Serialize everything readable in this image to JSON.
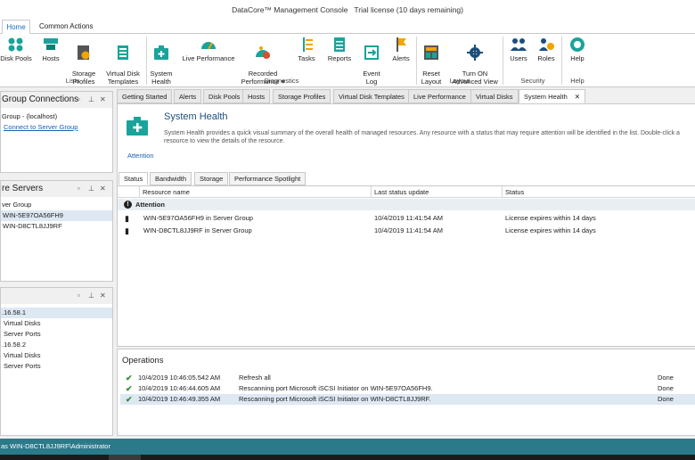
{
  "window": {
    "title": "DataCore™ Management Console",
    "license": "Trial license (10 days remaining)"
  },
  "ribbon_tabs": [
    "Home",
    "Common Actions"
  ],
  "ribbon": {
    "lists": {
      "label": "Lists",
      "buttons": [
        "Disk Pools",
        "Hosts",
        "Storage\nProfiles",
        "Virtual Disk\nTemplates"
      ]
    },
    "diagnostics": {
      "label": "Diagnostics",
      "buttons": [
        "System\nHealth",
        "Live Performance",
        "Recorded\nPerformance ▾",
        "Tasks",
        "Reports",
        "Event\nLog",
        "Alerts"
      ]
    },
    "layout": {
      "label": "Layout",
      "buttons": [
        "Reset\nLayout",
        "Turn ON\nAdvanced View"
      ]
    },
    "security": {
      "label": "Security",
      "buttons": [
        "Users",
        "Roles"
      ]
    },
    "help": {
      "label": "Help",
      "buttons": [
        "Help"
      ]
    }
  },
  "left_panels": {
    "group_connections": {
      "title": "Group Connections",
      "items": [
        "Group - (localhost)",
        "Connect to Server Group"
      ]
    },
    "servers": {
      "title": "re Servers",
      "items": [
        "ver Group",
        "WIN-5E97OA56FH9",
        "WIN-D8CTL8JJ9RF"
      ]
    },
    "ports": {
      "items": [
        ".16.58.1",
        "Virtual Disks",
        "Server Ports",
        ".16.58.2",
        "Virtual Disks",
        "Server Ports"
      ]
    }
  },
  "doc_tabs": [
    "Getting Started",
    "Alerts",
    "Disk Pools",
    "Hosts",
    "Storage Profiles",
    "Virtual Disk Templates",
    "Live Performance",
    "Virtual Disks",
    "System Health"
  ],
  "system_health": {
    "title": "System Health",
    "description": "System Health provides a quick visual summary of the overall health of managed resources. Any resource with a status that may require attention will be identified in the list. Double-click a resource to view the details of the resource.",
    "attention_link": "Attention",
    "subtabs": [
      "Status",
      "Bandwidth",
      "Storage",
      "Performance Spotlight"
    ],
    "columns": [
      "Resource name",
      "Last status update",
      "Status"
    ],
    "group_label": "Attention",
    "rows": [
      {
        "name": "WIN-5E97OA56FH9 in Server Group",
        "updated": "10/4/2019 11:41:54 AM",
        "status": "License expires within 14 days"
      },
      {
        "name": "WIN-D8CTL8JJ9RF in Server Group",
        "updated": "10/4/2019 11:41:54 AM",
        "status": "License expires within 14 days"
      }
    ]
  },
  "operations": {
    "title": "Operations",
    "rows": [
      {
        "time": "10/4/2019 10:46:05.542 AM",
        "desc": "Refresh all",
        "result": "Done"
      },
      {
        "time": "10/4/2019 10:46:44.605 AM",
        "desc": "Rescanning port Microsoft iSCSI Initiator on WIN-5E97OA56FH9.",
        "result": "Done"
      },
      {
        "time": "10/4/2019 10:46:49.355 AM",
        "desc": "Rescanning port Microsoft iSCSI Initiator on WIN-D8CTL8JJ9RF.",
        "result": "Done"
      }
    ]
  },
  "status_bar": {
    "text": " as WIN-D8CTL8JJ9RF\\Administrator"
  },
  "colors": {
    "accent": "#1a6dbf",
    "teal": "#1aa39b",
    "statusbar": "#2a7a8a",
    "check": "#2e8b2e"
  }
}
